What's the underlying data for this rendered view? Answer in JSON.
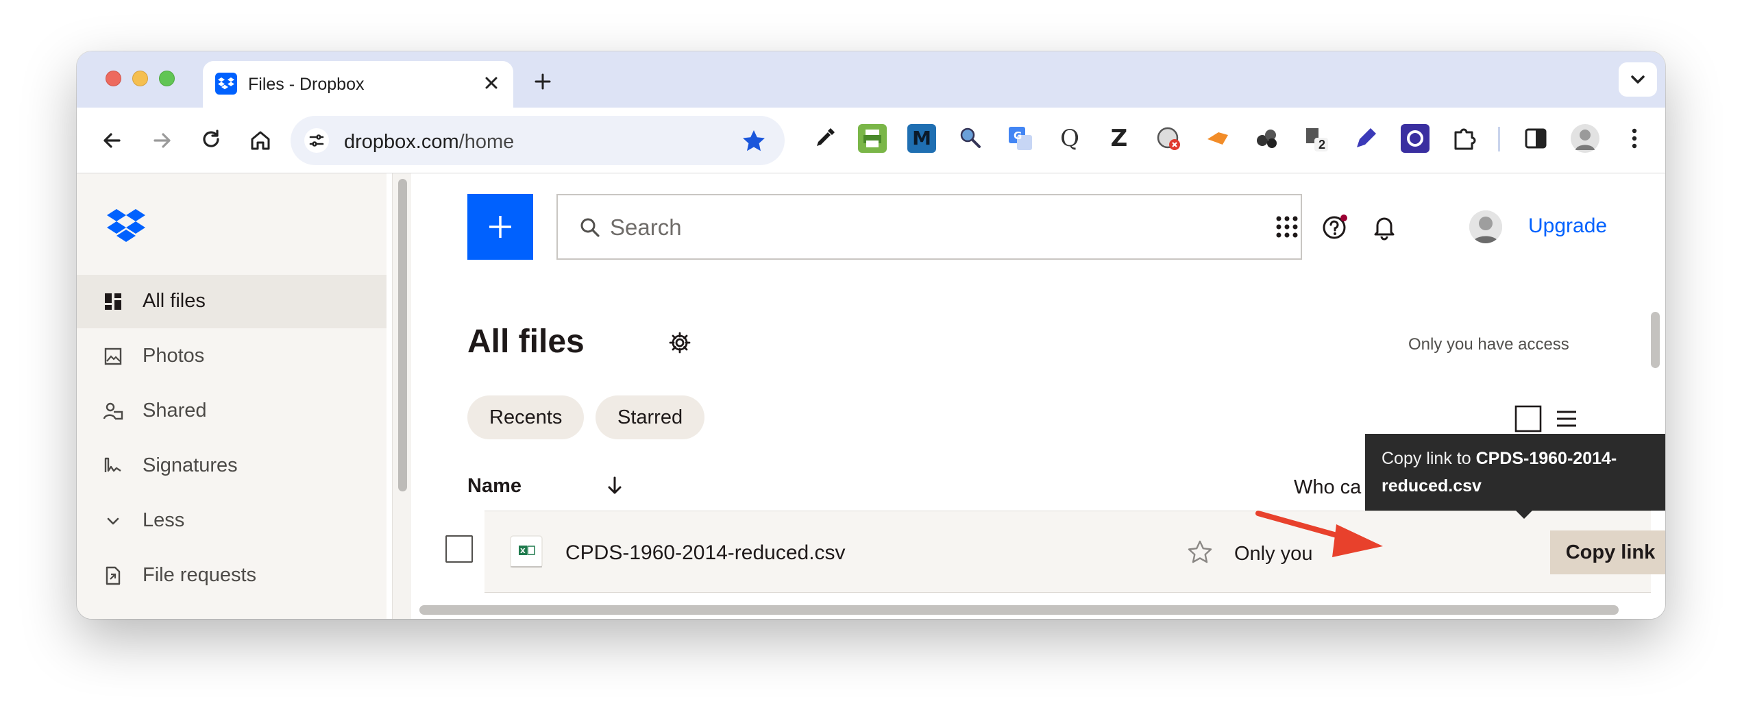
{
  "browser": {
    "tab_title": "Files - Dropbox",
    "url_domain": "dropbox.com",
    "url_path": "/home",
    "extension_badge": "2",
    "extensions": [
      "eyedropper-icon",
      "printer-icon",
      "m-icon",
      "magnifier-icon",
      "translate-icon",
      "q-icon",
      "z-icon",
      "blocked-icon",
      "tag-icon",
      "balls-icon",
      "counter-icon",
      "pen-icon",
      "o-icon",
      "puzzle-icon"
    ]
  },
  "sidebar": {
    "items": [
      {
        "label": "All files",
        "icon": "all-files-icon",
        "active": true
      },
      {
        "label": "Photos",
        "icon": "photos-icon"
      },
      {
        "label": "Shared",
        "icon": "shared-icon"
      },
      {
        "label": "Signatures",
        "icon": "signature-icon"
      },
      {
        "label": "Less",
        "icon": "chevron-down-icon"
      },
      {
        "label": "File requests",
        "icon": "file-request-icon"
      }
    ]
  },
  "header": {
    "search_placeholder": "Search",
    "upgrade_label": "Upgrade"
  },
  "main": {
    "title": "All files",
    "access_note": "Only you have access",
    "chips": [
      "Recents",
      "Starred"
    ],
    "columns": {
      "name": "Name",
      "who": "Who ca"
    },
    "file": {
      "name": "CPDS-1960-2014-reduced.csv",
      "access": "Only you",
      "copy_label": "Copy link"
    },
    "tooltip": {
      "prefix": "Copy link to ",
      "filename": "CPDS-1960-2014-reduced.csv"
    }
  },
  "colors": {
    "accent": "#0061fe",
    "annotation": "#e8412c"
  }
}
